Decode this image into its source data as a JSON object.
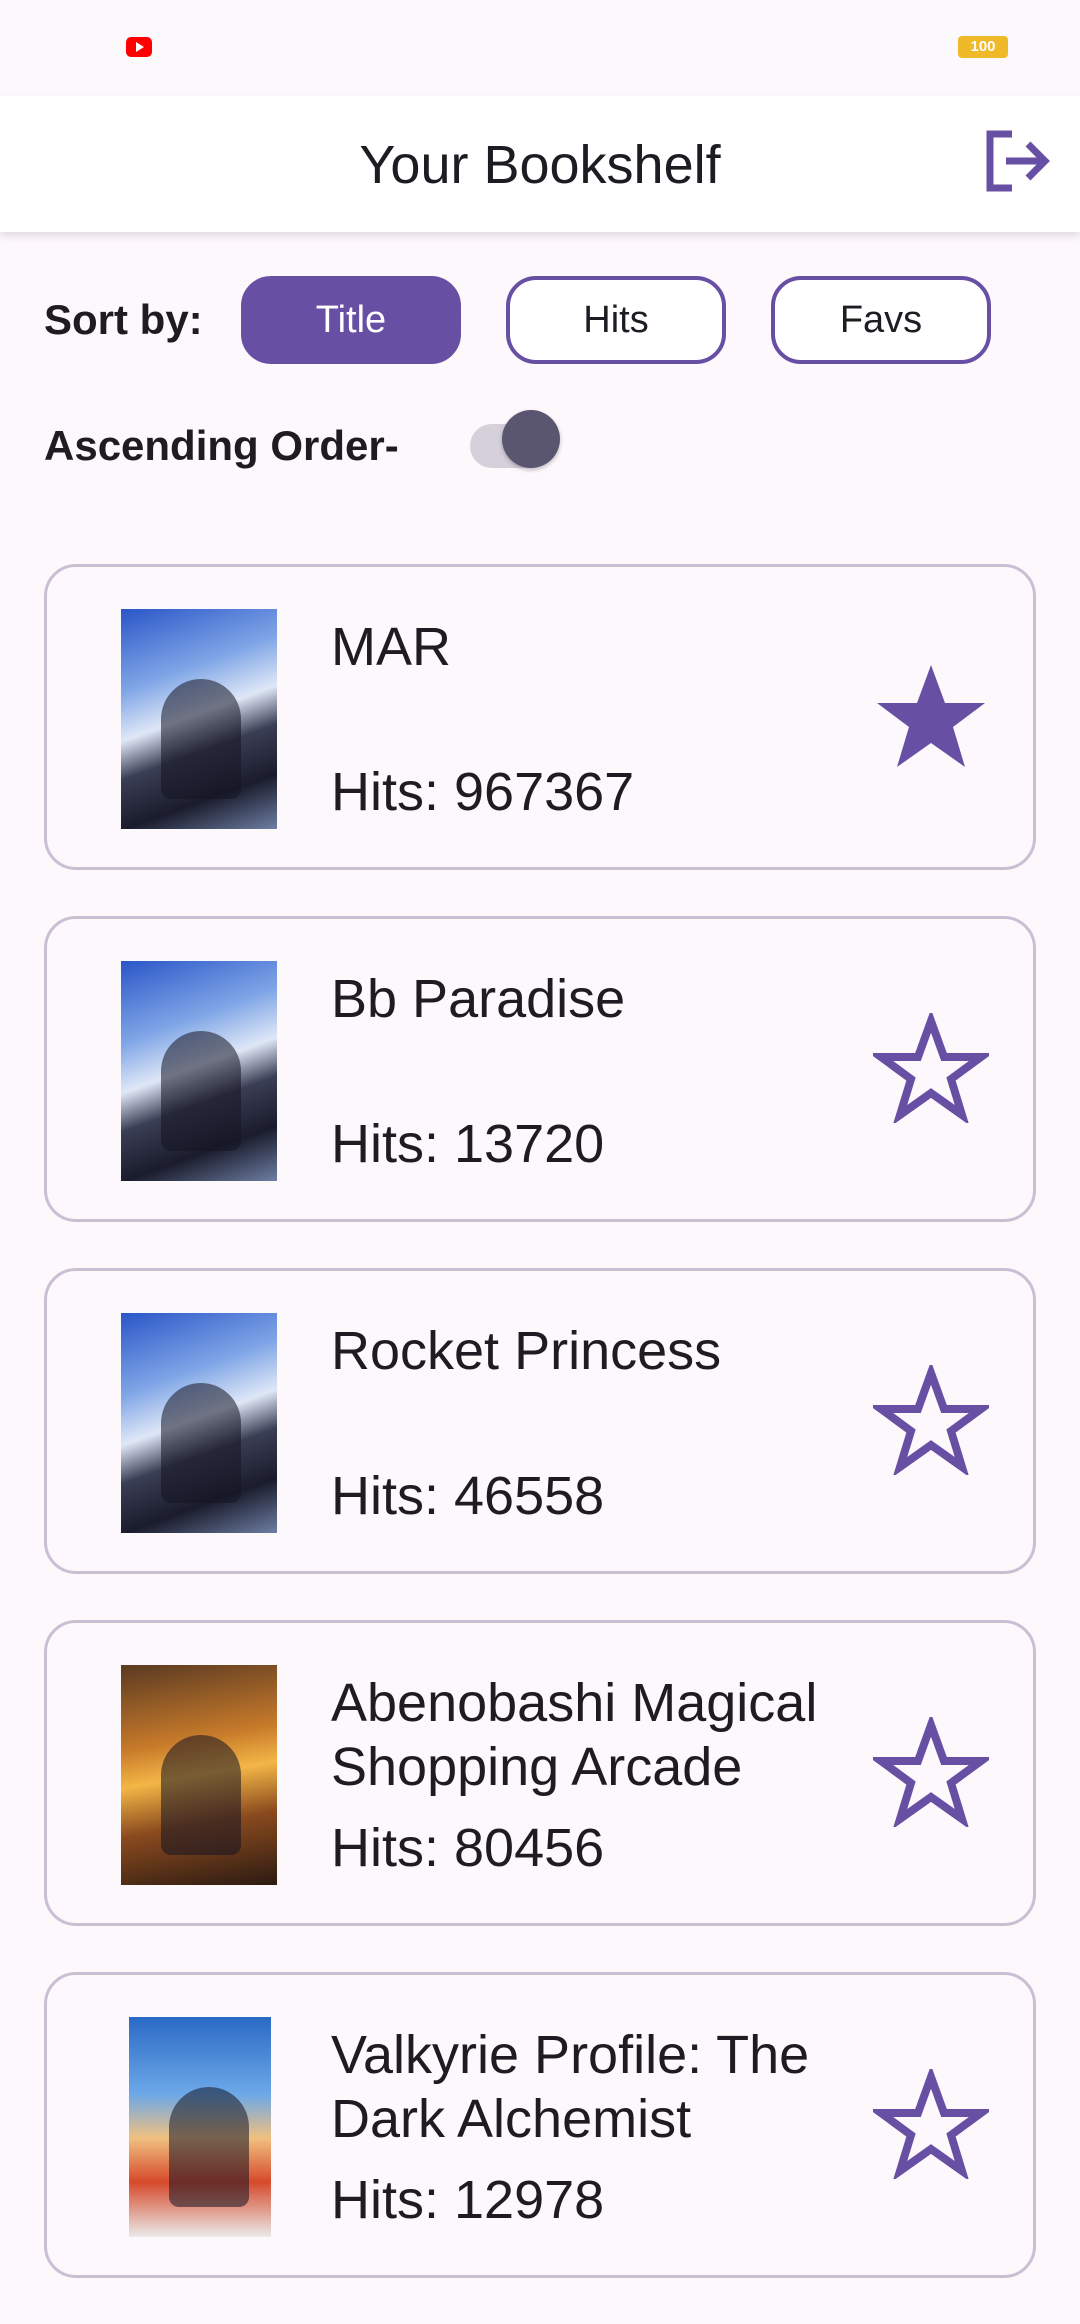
{
  "status_bar": {
    "battery": "100"
  },
  "header": {
    "title": "Your Bookshelf"
  },
  "sort": {
    "label": "Sort by:",
    "options": [
      "Title",
      "Hits",
      "Favs"
    ],
    "selected": "Title"
  },
  "order": {
    "label": "Ascending Order-",
    "enabled": true
  },
  "colors": {
    "accent": "#6750a4",
    "card_border": "#cbbfd3",
    "background": "#fdf8fc"
  },
  "books": [
    {
      "title": "MAR",
      "hits": "Hits: 967367",
      "favorite": true,
      "cover_icon": "jujutsu-cover"
    },
    {
      "title": "Bb Paradise",
      "hits": "Hits: 13720",
      "favorite": false,
      "cover_icon": "jujutsu-cover"
    },
    {
      "title": "Rocket Princess",
      "hits": "Hits: 46558",
      "favorite": false,
      "cover_icon": "jujutsu-cover"
    },
    {
      "title": "Abenobashi Magical Shopping Arcade",
      "hits": "Hits: 80456",
      "favorite": false,
      "cover_icon": "attack-on-titan-cover"
    },
    {
      "title": "Valkyrie Profile: The Dark Alchemist",
      "hits": "Hits: 12978",
      "favorite": false,
      "cover_icon": "one-piece-cover"
    }
  ]
}
